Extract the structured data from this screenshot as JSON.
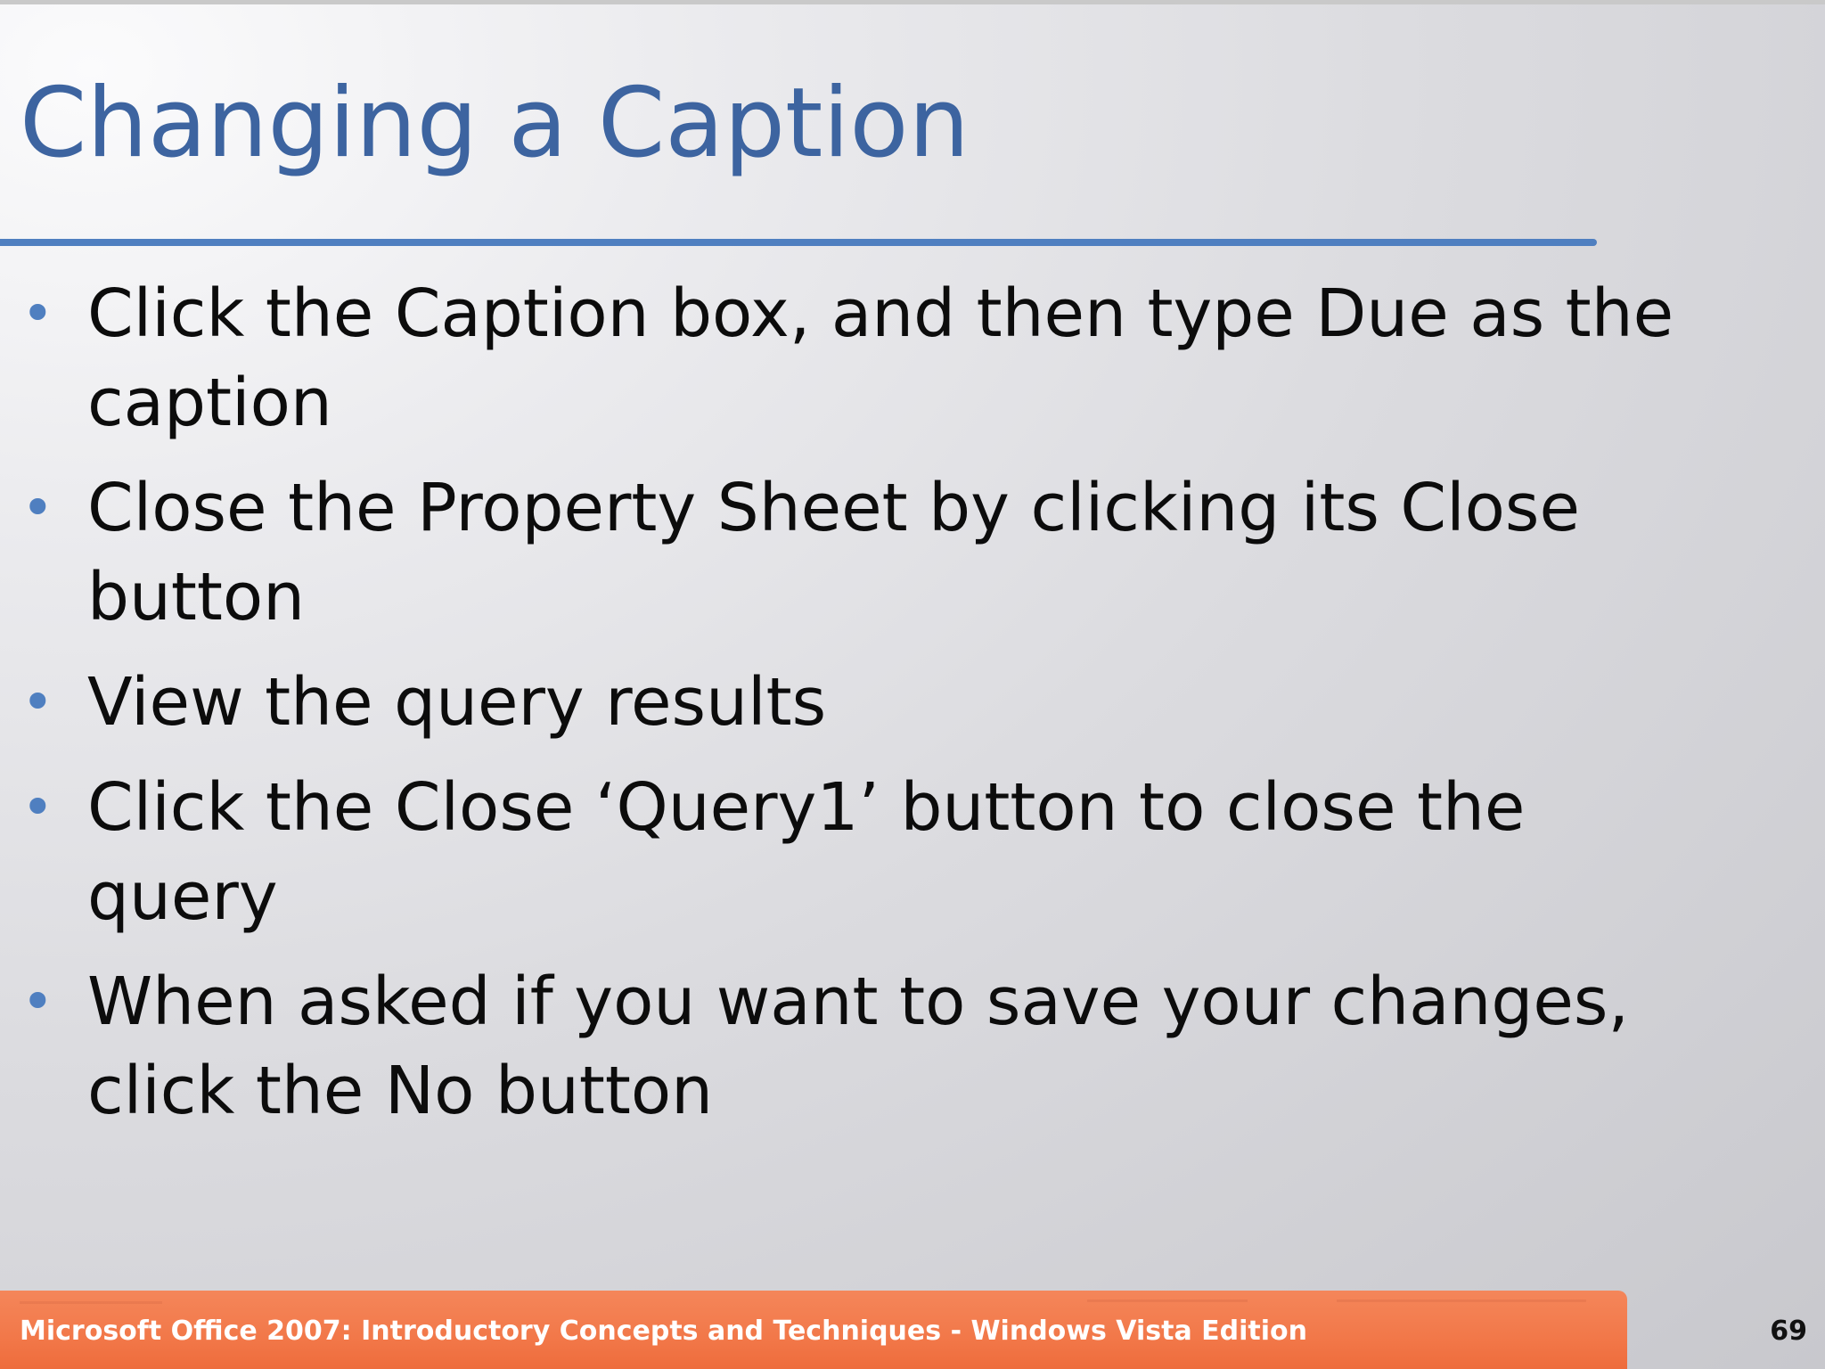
{
  "slide": {
    "title": "Changing a Caption",
    "bullets": [
      "Click the Caption box, and then type Due as the caption",
      "Close the Property Sheet by clicking its Close button",
      "View the query results",
      "Click the Close ‘Query1’ button to close the query",
      "When asked if you want to save your changes, click the No button"
    ],
    "bullet_glyph": "•",
    "footer_text": "Microsoft Office 2007: Introductory Concepts and Techniques - Windows Vista Edition",
    "page_number": "69"
  },
  "colors": {
    "title": "#3d64a0",
    "rule": "#4f7fc0",
    "bullet_dot": "#4f7fc0",
    "body_text": "#0c0c0c",
    "footer_bar": "#f27849",
    "footer_text": "#ffffff"
  }
}
